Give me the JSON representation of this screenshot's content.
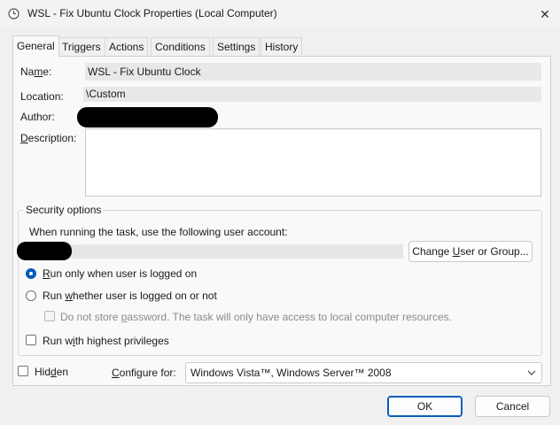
{
  "window": {
    "title": "WSL - Fix Ubuntu Clock Properties (Local Computer)",
    "close_glyph": "✕",
    "icon": "clock-icon"
  },
  "tabs": [
    {
      "label": "General",
      "active": true
    },
    {
      "label": "Triggers",
      "active": false
    },
    {
      "label": "Actions",
      "active": false
    },
    {
      "label": "Conditions",
      "active": false
    },
    {
      "label": "Settings",
      "active": false
    },
    {
      "label": "History",
      "active": false
    }
  ],
  "general": {
    "name_label_pre": "Na",
    "name_label_ul": "m",
    "name_label_post": "e:",
    "name_value": "WSL - Fix Ubuntu Clock",
    "location_label": "Location:",
    "location_value": "\\Custom",
    "author_label": "Author:",
    "description_label_ul": "D",
    "description_label_post": "escription:",
    "description_value": ""
  },
  "security": {
    "legend": "Security options",
    "account_prompt": "When running the task, use the following user account:",
    "change_button_pre": "Change ",
    "change_button_ul": "U",
    "change_button_post": "ser or Group...",
    "radio_logged_on_ul": "R",
    "radio_logged_on_post": "un only when user is logged on",
    "radio_whether_pre": "Run ",
    "radio_whether_ul": "w",
    "radio_whether_post": "hether user is logged on or not",
    "do_not_store_pre": "Do not store ",
    "do_not_store_ul": "p",
    "do_not_store_post": "assword.  The task will only have access to local computer resources.",
    "highest_pre": "Run w",
    "highest_ul": "i",
    "highest_post": "th highest privileges",
    "selected_option": "run-only-when-logged-on",
    "do_not_store_checked": false,
    "highest_checked": false
  },
  "footer": {
    "hidden_pre": "Hid",
    "hidden_ul": "d",
    "hidden_post": "en",
    "hidden_checked": false,
    "configure_ul": "C",
    "configure_post": "onfigure for:",
    "configure_value": "Windows Vista™, Windows Server™ 2008",
    "ok_label": "OK",
    "cancel_label": "Cancel"
  },
  "colors": {
    "accent": "#005fb8",
    "redaction": "#000000"
  }
}
